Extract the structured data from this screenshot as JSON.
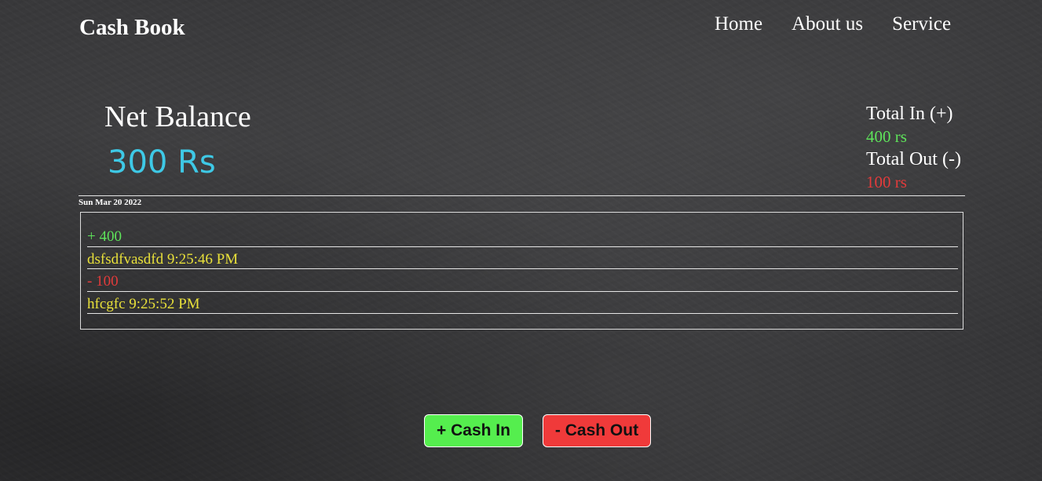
{
  "app": {
    "title": "Cash Book"
  },
  "nav": {
    "items": [
      "Home",
      "About us",
      "Service"
    ]
  },
  "balance": {
    "label": "Net Balance",
    "value": "300 Rs",
    "total_in_label": "Total In (+)",
    "total_in_value": "400 rs",
    "total_out_label": "Total Out (-)",
    "total_out_value": "100 rs"
  },
  "ledger": {
    "date": "Sun Mar 20 2022",
    "entries": [
      {
        "amount": "+ 400",
        "note": "dsfsdfvasdfd 9:25:46 PM"
      },
      {
        "amount": "- 100",
        "note": "hfcgfc 9:25:52 PM"
      }
    ]
  },
  "actions": {
    "cash_in": "+ Cash In",
    "cash_out": "- Cash Out"
  },
  "colors": {
    "in": "#5ee35a",
    "out": "#e43b3b",
    "note": "#e8e03a",
    "balance": "#3ec9e6",
    "cash_in_button": "#55ee4e",
    "cash_out_button": "#f03a3a"
  }
}
